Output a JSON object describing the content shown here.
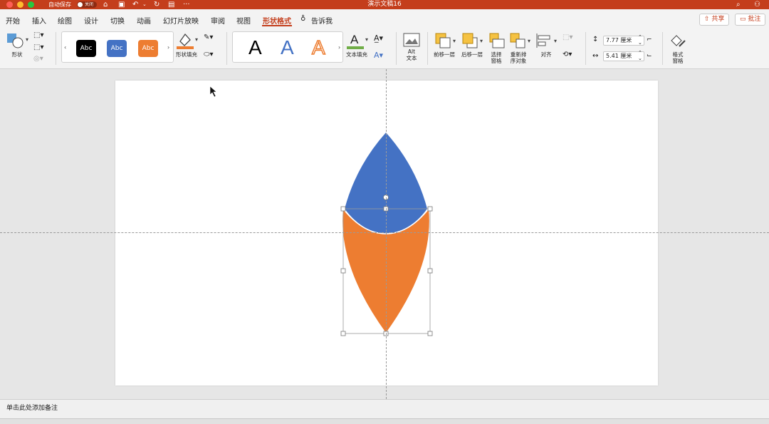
{
  "titlebar": {
    "autosave_label": "自动保存",
    "autosave_state": "关闭",
    "doc_title": "演示文稿16"
  },
  "tabs": [
    {
      "label": "开始"
    },
    {
      "label": "插入"
    },
    {
      "label": "绘图"
    },
    {
      "label": "设计"
    },
    {
      "label": "切换"
    },
    {
      "label": "动画"
    },
    {
      "label": "幻灯片放映"
    },
    {
      "label": "审阅"
    },
    {
      "label": "视图"
    },
    {
      "label": "形状格式",
      "active": true
    }
  ],
  "tell_me": "告诉我",
  "share_label": "共享",
  "comment_label": "批注",
  "ribbon": {
    "shape_label": "形状",
    "style_swatches": [
      {
        "text": "Abc",
        "color": "#000000"
      },
      {
        "text": "Abc",
        "color": "#4472c4"
      },
      {
        "text": "Abc",
        "color": "#ed7d31"
      }
    ],
    "shape_fill_label": "形状填充",
    "wordart_letters": [
      "A",
      "A",
      "A"
    ],
    "text_fill_label": "文本填充",
    "alt_text_label": [
      "Alt",
      "文本"
    ],
    "bring_forward": "前移一层",
    "send_backward": "后移一层",
    "selection_pane": [
      "选择",
      "窗格"
    ],
    "reorder": [
      "重新排",
      "序对象"
    ],
    "align": "对齐",
    "height_value": "7.77 厘米",
    "width_value": "5.41 厘米",
    "format_pane": [
      "格式",
      "窗格"
    ]
  },
  "notes_placeholder": "单击此处添加备注",
  "colors": {
    "accent": "#c43e1c",
    "blue_shape": "#4472c4",
    "orange_shape": "#ed7d31"
  }
}
